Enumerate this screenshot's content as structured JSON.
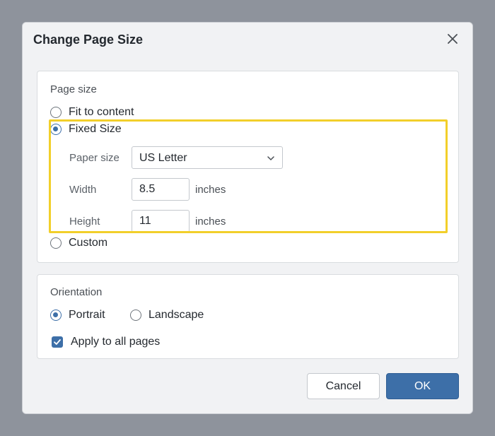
{
  "dialog": {
    "title": "Change Page Size",
    "close_icon": "close-icon"
  },
  "page_size": {
    "section_title": "Page size",
    "options": [
      {
        "label": "Fit to content",
        "checked": false
      },
      {
        "label": "Fixed Size",
        "checked": true
      },
      {
        "label": "Custom",
        "checked": false
      }
    ],
    "paper_size_label": "Paper size",
    "paper_size_value": "US Letter",
    "width_label": "Width",
    "width_value": "8.5",
    "height_label": "Height",
    "height_value": "11",
    "unit_label": "inches"
  },
  "orientation": {
    "section_title": "Orientation",
    "options": [
      {
        "label": "Portrait",
        "checked": true
      },
      {
        "label": "Landscape",
        "checked": false
      }
    ],
    "apply_all_label": "Apply to all pages",
    "apply_all_checked": true
  },
  "buttons": {
    "cancel_label": "Cancel",
    "ok_label": "OK"
  },
  "colors": {
    "accent": "#3d6fa8",
    "highlight": "#f2cf2a",
    "backdrop": "#8e939c"
  }
}
